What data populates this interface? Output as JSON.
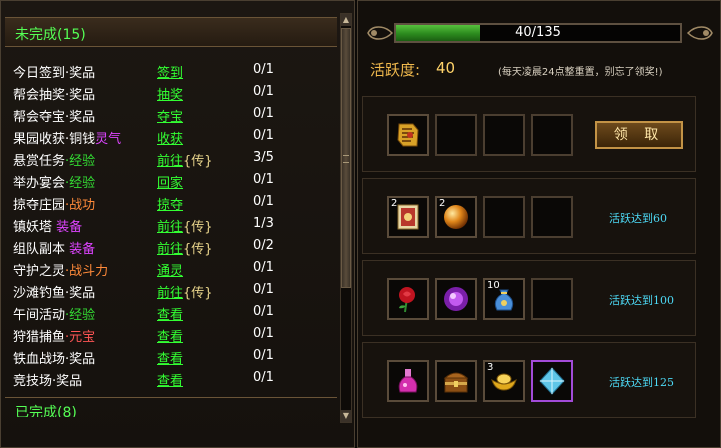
{
  "left": {
    "header": "未完成(15)",
    "footer": "已完成(8)",
    "tasks": [
      {
        "name_a": "今日签到",
        "name_b": "·奖品",
        "b_color": "white",
        "link": "签到",
        "tag": "",
        "prog": "0/1"
      },
      {
        "name_a": "帮会抽奖",
        "name_b": "·奖品",
        "b_color": "white",
        "link": "抽奖",
        "tag": "",
        "prog": "0/1"
      },
      {
        "name_a": "帮会夺宝",
        "name_b": "·奖品",
        "b_color": "white",
        "link": "夺宝",
        "tag": "",
        "prog": "0/1"
      },
      {
        "name_a": "果园收获",
        "name_b": "·铜钱",
        "b_color": "white",
        "name_c": "灵气",
        "link": "收获",
        "tag": "",
        "prog": "0/1"
      },
      {
        "name_a": "悬赏任务",
        "name_b": "·经验",
        "b_color": "green",
        "link": "前往",
        "tag": "{传}",
        "prog": "3/5"
      },
      {
        "name_a": "举办宴会",
        "name_b": "·经验",
        "b_color": "green",
        "link": "回家",
        "tag": "",
        "prog": "0/1"
      },
      {
        "name_a": "掠夺庄园",
        "name_b": "·战功",
        "b_color": "orange",
        "link": "掠夺",
        "tag": "",
        "prog": "0/1"
      },
      {
        "name_a": "镇妖塔",
        "name_b": " 装备",
        "b_color": "purple",
        "link": "前往",
        "tag": "{传}",
        "prog": "1/3"
      },
      {
        "name_a": "组队副本",
        "name_b": " 装备",
        "b_color": "purple",
        "link": "前往",
        "tag": "{传}",
        "prog": "0/2"
      },
      {
        "name_a": "守护之灵",
        "name_b": "·战斗力",
        "b_color": "orange",
        "link": "通灵",
        "tag": "",
        "prog": "0/1"
      },
      {
        "name_a": "沙滩钓鱼",
        "name_b": "·奖品",
        "b_color": "white",
        "link": "前往",
        "tag": "{传}",
        "prog": "0/1"
      },
      {
        "name_a": "午间活动",
        "name_b": "·经验",
        "b_color": "green",
        "link": "查看",
        "tag": "",
        "prog": "0/1"
      },
      {
        "name_a": "狩猎捕鱼",
        "name_b": "·元宝",
        "b_color": "red",
        "link": "查看",
        "tag": "",
        "prog": "0/1"
      },
      {
        "name_a": "铁血战场",
        "name_b": "·奖品",
        "b_color": "white",
        "link": "查看",
        "tag": "",
        "prog": "0/1"
      },
      {
        "name_a": "竞技场",
        "name_b": "·奖品",
        "b_color": "white",
        "link": "查看",
        "tag": "",
        "prog": "0/1"
      }
    ]
  },
  "right": {
    "progress": {
      "text": "40/135",
      "current": 40,
      "max": 135
    },
    "activity_label": "活跃度:",
    "activity_value": "40",
    "note": "(每天凌晨24点整重置，别忘了领奖!)",
    "claim_button": "领 取",
    "rewards": [
      {
        "text": "",
        "slots": [
          {
            "icon": "scroll-icon",
            "count": ""
          },
          {
            "icon": "empty",
            "count": ""
          },
          {
            "icon": "empty",
            "count": ""
          },
          {
            "icon": "empty",
            "count": ""
          }
        ]
      },
      {
        "text": "活跃达到60",
        "slots": [
          {
            "icon": "talisman-icon",
            "count": "2"
          },
          {
            "icon": "orb-icon",
            "count": "2"
          },
          {
            "icon": "empty",
            "count": ""
          },
          {
            "icon": "empty",
            "count": ""
          }
        ]
      },
      {
        "text": "活跃达到100",
        "slots": [
          {
            "icon": "rose-icon",
            "count": ""
          },
          {
            "icon": "gem-icon",
            "count": ""
          },
          {
            "icon": "pouch-icon",
            "count": "10"
          },
          {
            "icon": "empty",
            "count": ""
          }
        ]
      },
      {
        "text": "活跃达到125",
        "slots": [
          {
            "icon": "potion-icon",
            "count": ""
          },
          {
            "icon": "chest-icon",
            "count": ""
          },
          {
            "icon": "ingot-icon",
            "count": "3"
          },
          {
            "icon": "crystal-icon",
            "count": ""
          }
        ]
      }
    ]
  }
}
